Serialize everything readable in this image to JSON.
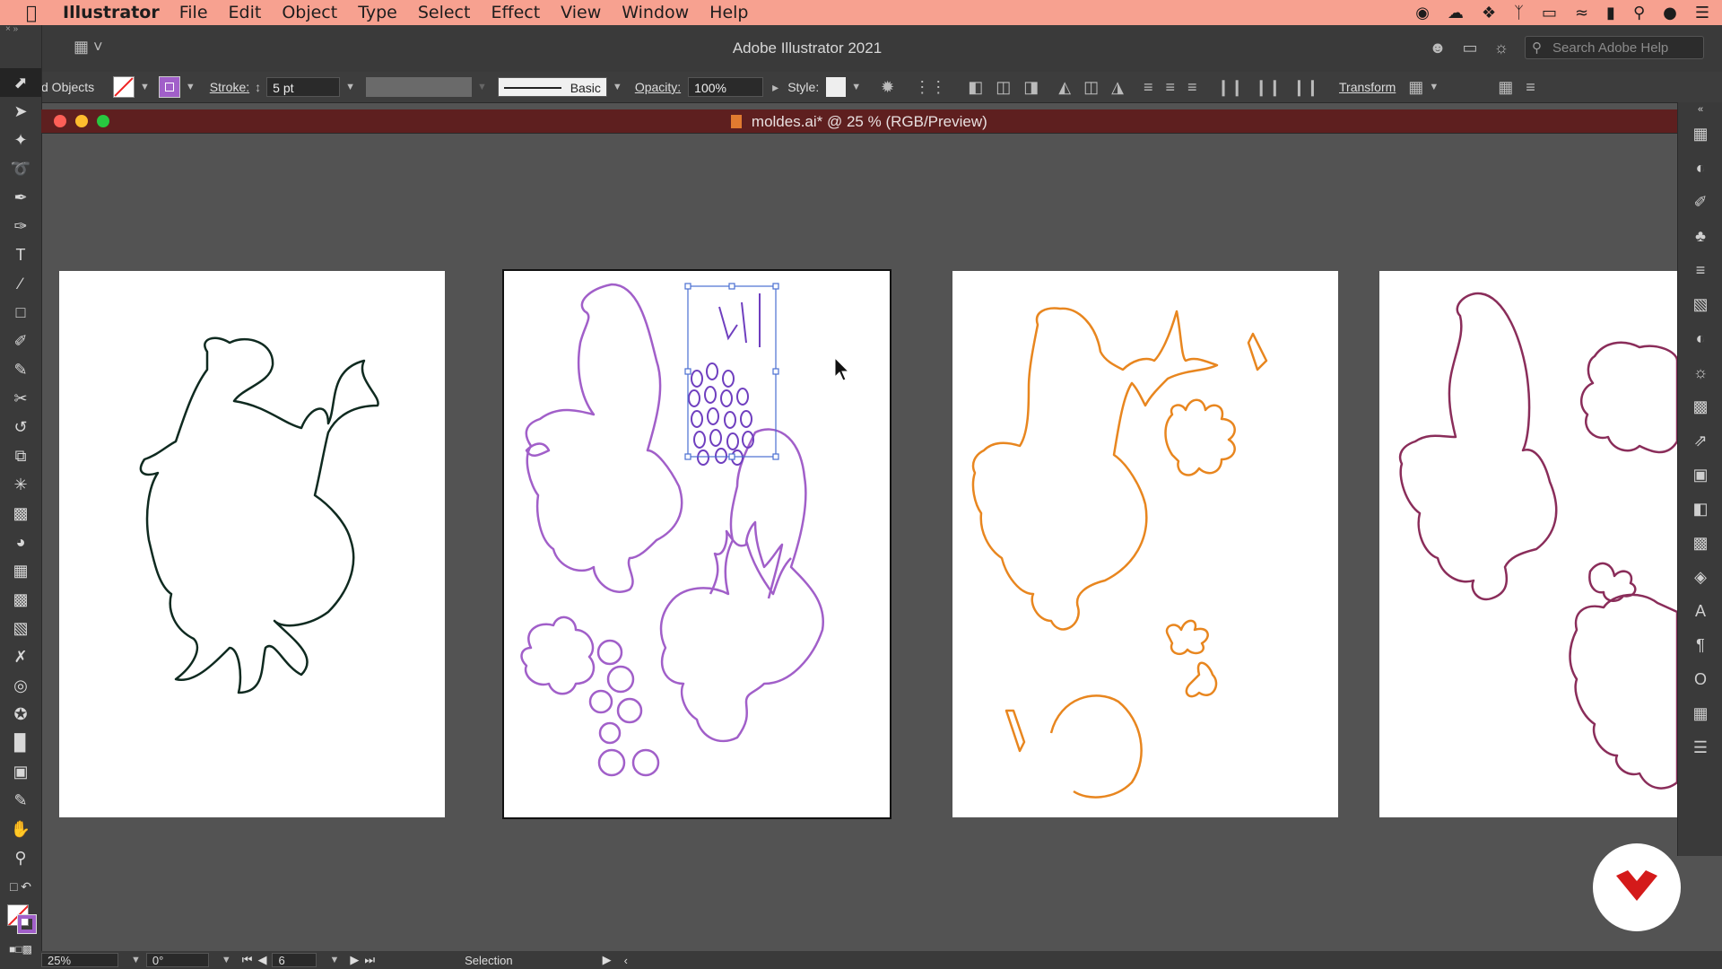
{
  "menubar": {
    "app_name": "Illustrator",
    "items": [
      "File",
      "Edit",
      "Object",
      "Type",
      "Select",
      "Effect",
      "View",
      "Window",
      "Help"
    ]
  },
  "appbar": {
    "title": "Adobe Illustrator 2021",
    "search_placeholder": "Search Adobe Help"
  },
  "control": {
    "selection_label": "d Objects",
    "stroke_label": "Stroke:",
    "stroke_value": "5 pt",
    "brush_label": "Basic",
    "opacity_label": "Opacity:",
    "opacity_value": "100%",
    "style_label": "Style:",
    "transform_label": "Transform"
  },
  "document": {
    "tab_title": "moldes.ai* @ 25 % (RGB/Preview)"
  },
  "statusbar": {
    "zoom": "25%",
    "rotation": "0°",
    "artboard_number": "6",
    "tool_name": "Selection"
  },
  "colors": {
    "menubar": "#f7a190",
    "chrome": "#3a3a3a",
    "canvas": "#535353",
    "doc_tab": "#5e1f1f",
    "art_dark_green": "#0f2a20",
    "art_purple": "#a15fc9",
    "art_orange": "#e8861f",
    "art_plum": "#8a2d5a",
    "selection_box": "#4a6fd1",
    "logo_red": "#d41a1a"
  },
  "tools": [
    "selection-tool",
    "direct-selection-tool",
    "magic-wand-tool",
    "lasso-tool",
    "pen-tool",
    "curvature-tool",
    "type-tool",
    "line-tool",
    "rectangle-tool",
    "paintbrush-tool",
    "shaper-tool",
    "scissors-tool",
    "rotate-tool",
    "scale-tool",
    "puppet-warp-tool",
    "free-transform-tool",
    "shape-builder-tool",
    "perspective-grid-tool",
    "mesh-tool",
    "gradient-tool",
    "eyedropper-tool",
    "blend-tool",
    "symbol-sprayer-tool",
    "column-graph-tool",
    "artboard-tool",
    "slice-tool",
    "hand-tool",
    "zoom-tool"
  ]
}
